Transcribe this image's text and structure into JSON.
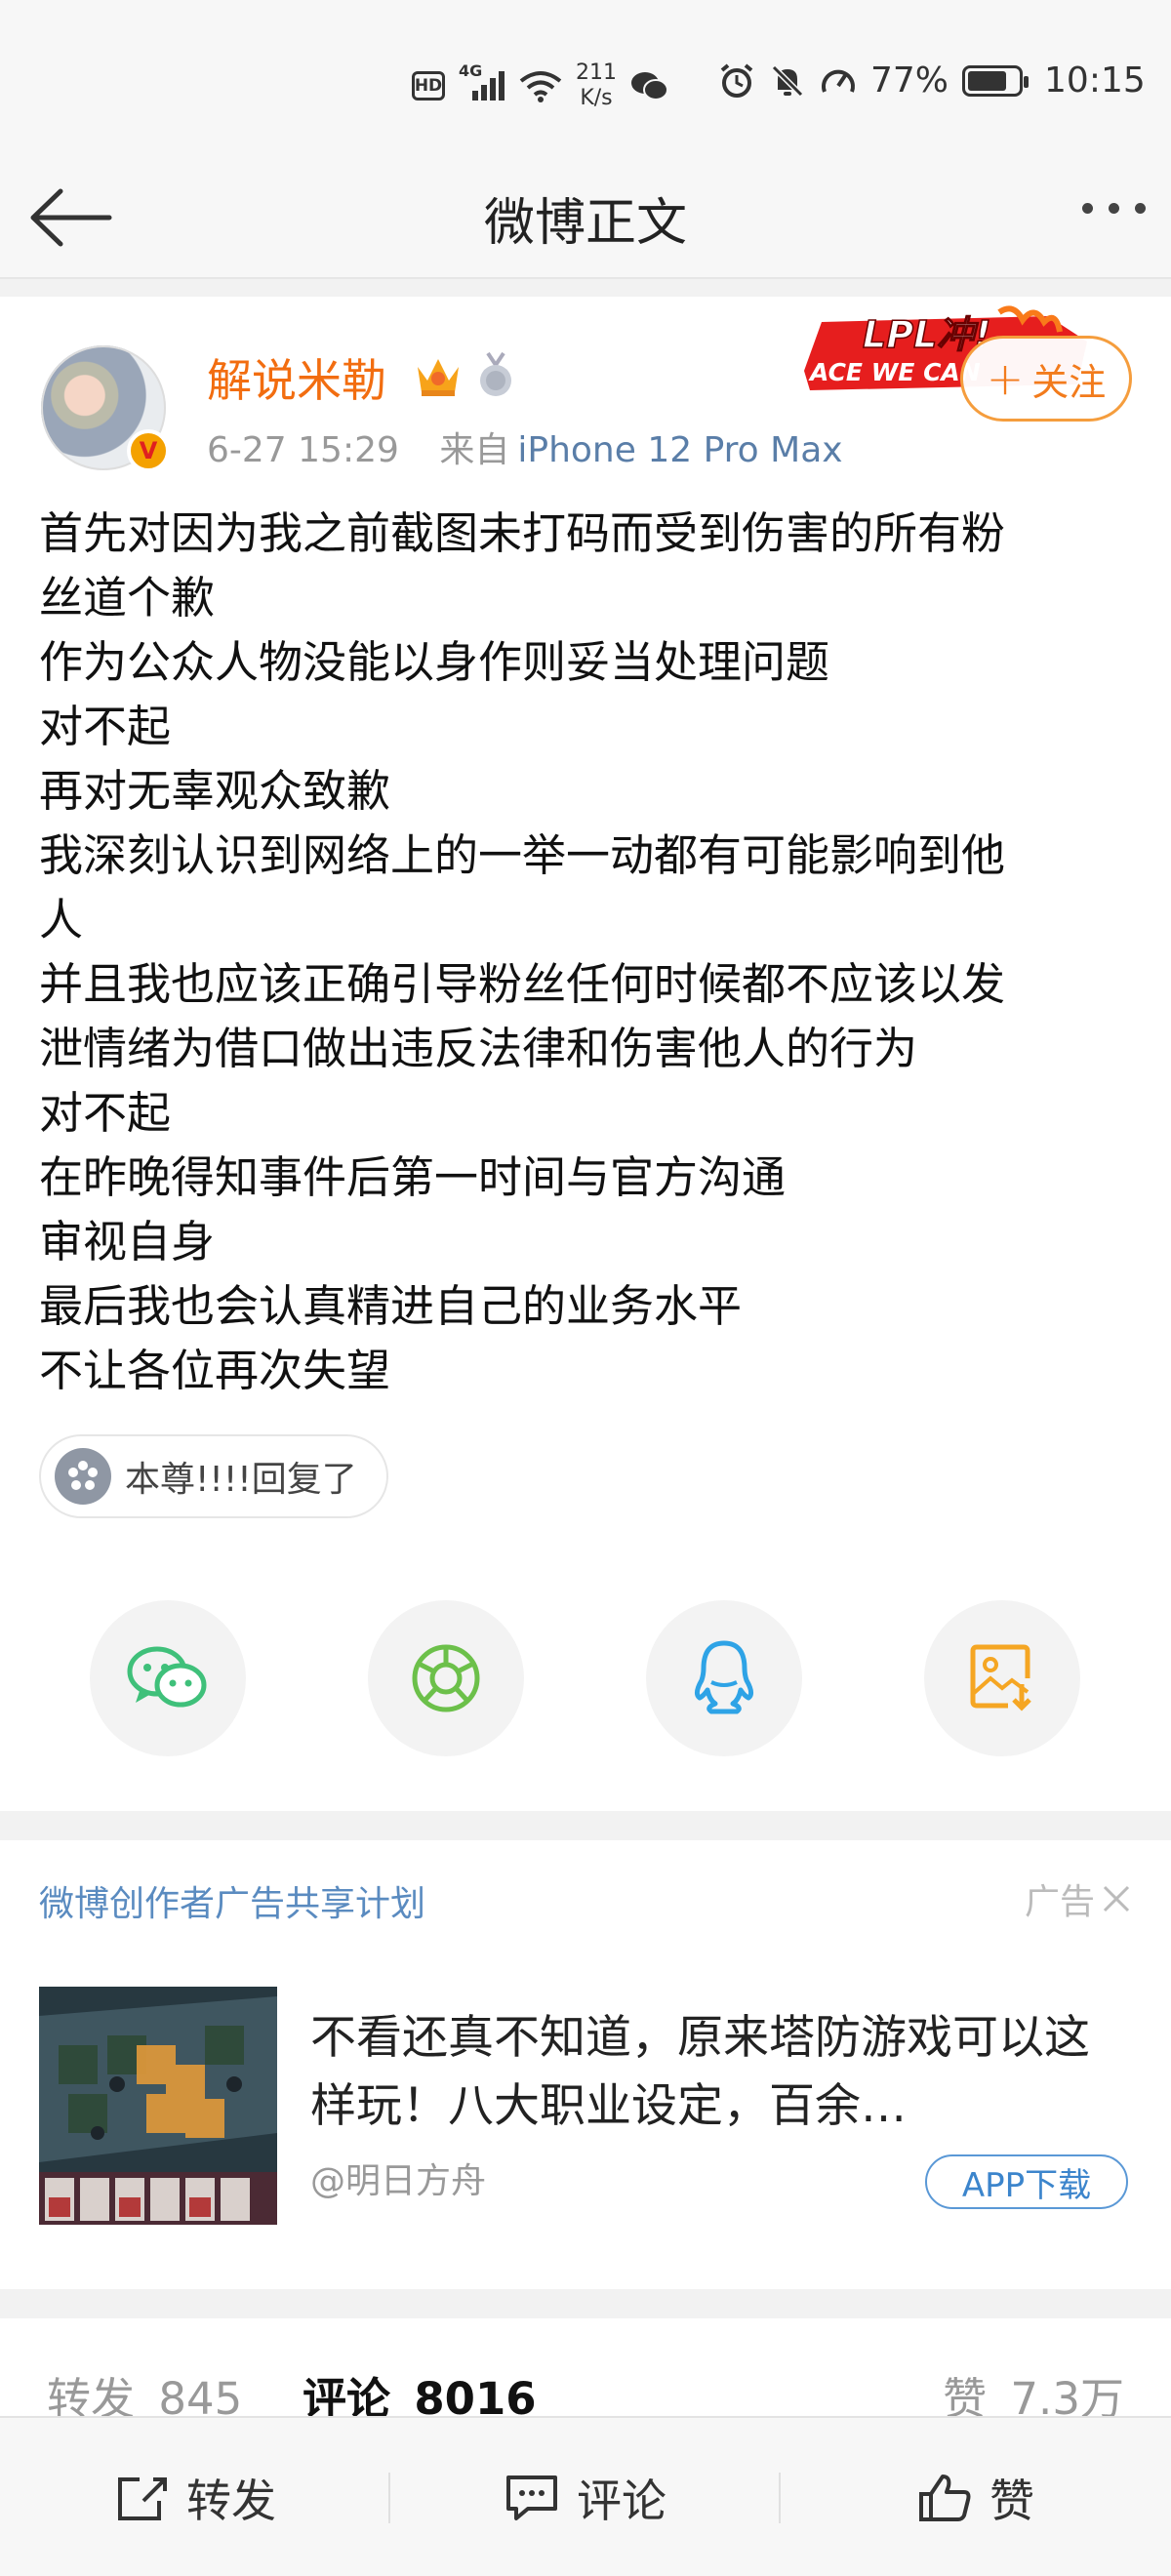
{
  "status_bar": {
    "hd": "HD",
    "network": "4G",
    "speed_value": "211",
    "speed_unit": "K/s",
    "battery": "77%",
    "battery_level": 0.77,
    "time": "10:15"
  },
  "nav": {
    "title": "微博正文"
  },
  "post": {
    "author": "解说米勒",
    "timestamp": "6-27 15:29",
    "source_prefix": "来自",
    "source_device": "iPhone 12 Pro Max",
    "follow_label": "关注",
    "banner_text_top": "LPL冲!",
    "banner_text_bottom": "ACE WE CAN",
    "verified_mark": "V",
    "lines": [
      "首先对因为我之前截图未打码而受到伤害的所有粉",
      "丝道个歉",
      "作为公众人物没能以身作则妥当处理问题",
      "对不起",
      "再对无辜观众致歉",
      "我深刻认识到网络上的一举一动都有可能影响到他",
      "人",
      "并且我也应该正确引导粉丝任何时候都不应该以发",
      "泄情绪为借口做出违反法律和伤害他人的行为",
      "对不起",
      "在昨晚得知事件后第一时间与官方沟通",
      "审视自身",
      "最后我也会认真精进自己的业务水平",
      "不让各位再次失望"
    ],
    "super_topic": "本尊!!!!回复了",
    "share_targets": [
      {
        "icon": "wechat-icon",
        "color": "#3fc07a"
      },
      {
        "icon": "moments-icon",
        "color": "#6cc04a"
      },
      {
        "icon": "qq-icon",
        "color": "#2ea3e6"
      },
      {
        "icon": "save-image-icon",
        "color": "#f5a623"
      }
    ]
  },
  "ad": {
    "title": "微博创作者广告共享计划",
    "label": "广告",
    "text": "不看还真不知道，原来塔防游戏可以这样玩！八大职业设定，百余…",
    "source": "@明日方舟",
    "download_label": "APP下载"
  },
  "stats": {
    "repost_label": "转发",
    "repost_count": "845",
    "comment_label": "评论",
    "comment_count": "8016",
    "like_label": "赞",
    "like_count": "7.3万"
  },
  "bottom_bar": {
    "repost": "转发",
    "comment": "评论",
    "like": "赞"
  }
}
